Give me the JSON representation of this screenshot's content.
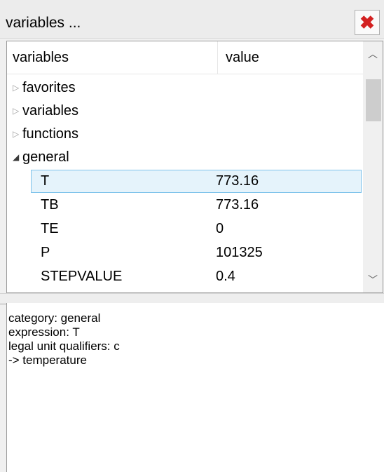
{
  "window": {
    "title": "variables ...",
    "close_icon": "close-icon"
  },
  "tree": {
    "columns": [
      "variables",
      "value"
    ],
    "groups": [
      {
        "label": "favorites",
        "expanded": false
      },
      {
        "label": "variables",
        "expanded": false
      },
      {
        "label": "functions",
        "expanded": false
      },
      {
        "label": "general",
        "expanded": true
      }
    ],
    "items": [
      {
        "name": "T",
        "value": "773.16",
        "selected": true
      },
      {
        "name": "TB",
        "value": "773.16",
        "selected": false
      },
      {
        "name": "TE",
        "value": "0",
        "selected": false
      },
      {
        "name": "P",
        "value": "101325",
        "selected": false
      },
      {
        "name": "STEPVALUE",
        "value": "0.4",
        "selected": false
      }
    ]
  },
  "info": {
    "lines": [
      "category: general",
      "expression: T",
      "legal unit qualifiers: c",
      "-> temperature"
    ]
  }
}
